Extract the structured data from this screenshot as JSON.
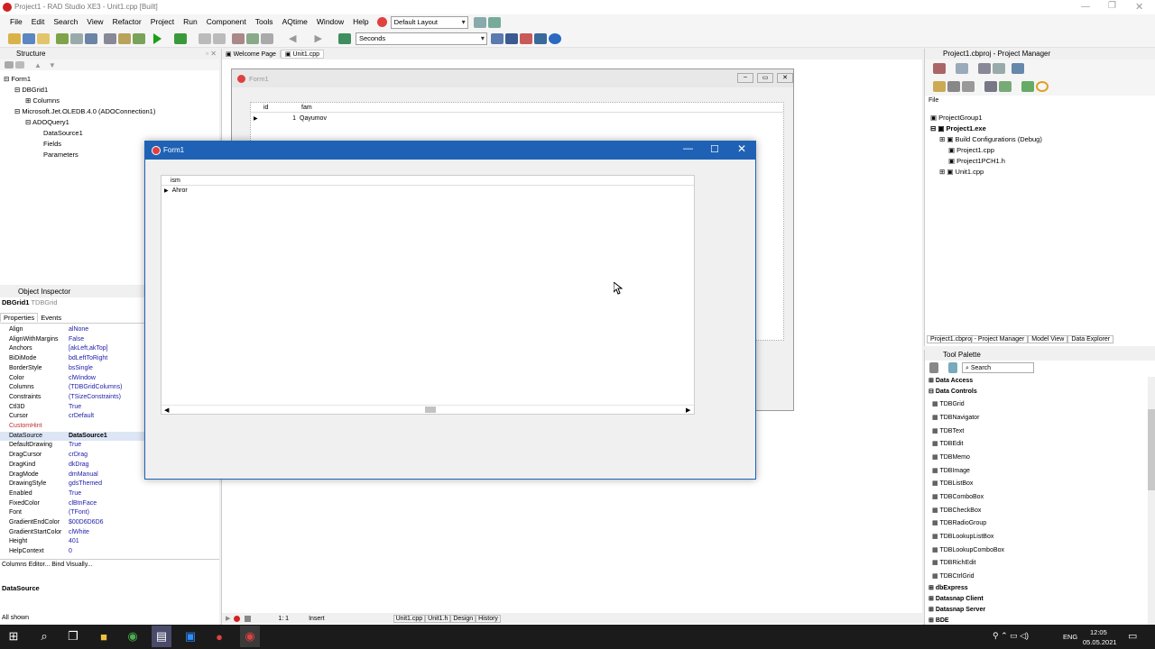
{
  "app": {
    "title": "Project1 - RAD Studio XE3 - Unit1.cpp [Built]",
    "menu": [
      "File",
      "Edit",
      "Search",
      "View",
      "Refactor",
      "Project",
      "Run",
      "Component",
      "Tools",
      "AQtime",
      "Window",
      "Help"
    ],
    "layout_combo": "Default Layout",
    "seconds_combo": "Seconds"
  },
  "structure": {
    "title": "Structure",
    "tree": [
      "Form1",
      "DBGrid1",
      "Columns",
      "Microsoft.Jet.OLEDB.4.0 (ADOConnection1)",
      "ADOQuery1",
      "DataSource1",
      "Fields",
      "Parameters"
    ]
  },
  "inspector": {
    "title": "Object Inspector",
    "component": "DBGrid1",
    "component_type": "TDBGrid",
    "tabs": [
      "Properties",
      "Events"
    ],
    "props": [
      [
        "Align",
        "alNone"
      ],
      [
        "AlignWithMargins",
        "False"
      ],
      [
        "Anchors",
        "[akLeft,akTop]"
      ],
      [
        "BiDiMode",
        "bdLeftToRight"
      ],
      [
        "BorderStyle",
        "bsSingle"
      ],
      [
        "Color",
        "clWindow"
      ],
      [
        "Columns",
        "(TDBGridColumns)"
      ],
      [
        "Constraints",
        "(TSizeConstraints)"
      ],
      [
        "Ctl3D",
        "True"
      ],
      [
        "Cursor",
        "crDefault"
      ],
      [
        "CustomHint",
        ""
      ],
      [
        "DataSource",
        "DataSource1"
      ],
      [
        "DefaultDrawing",
        "True"
      ],
      [
        "DragCursor",
        "crDrag"
      ],
      [
        "DragKind",
        "dkDrag"
      ],
      [
        "DragMode",
        "dmManual"
      ],
      [
        "DrawingStyle",
        "gdsThemed"
      ],
      [
        "Enabled",
        "True"
      ],
      [
        "FixedColor",
        "clBtnFace"
      ],
      [
        "Font",
        "(TFont)"
      ],
      [
        "GradientEndColor",
        "$00D6D6D6"
      ],
      [
        "GradientStartColor",
        "clWhite"
      ],
      [
        "Height",
        "401"
      ],
      [
        "HelpContext",
        "0"
      ]
    ],
    "links": "Columns Editor...  Bind Visually...",
    "footer_prop": "DataSource",
    "status": "All shown"
  },
  "editor": {
    "tabs": [
      "Welcome Page",
      "Unit1.cpp"
    ],
    "status_pos": "1:  1",
    "status_mode": "Insert",
    "bottom_tabs": [
      "Unit1.cpp",
      "Unit1.h",
      "Design",
      "History"
    ]
  },
  "design_form": {
    "title": "Form1",
    "headers": [
      "id",
      "fam"
    ],
    "row": [
      "1",
      "Qayumov"
    ]
  },
  "run_form": {
    "title": "Form1",
    "header": "ism",
    "row": "Ahror"
  },
  "project_manager": {
    "title": "Project1.cbproj - Project Manager",
    "file_label": "File",
    "tree": [
      "ProjectGroup1",
      "Project1.exe",
      "Build Configurations (Debug)",
      "Project1.cpp",
      "Project1PCH1.h",
      "Unit1.cpp"
    ],
    "tabs": [
      "Project1.cbproj - Project Manager",
      "Model View",
      "Data Explorer"
    ]
  },
  "tool_palette": {
    "title": "Tool Palette",
    "search_placeholder": "Search",
    "categories": [
      "Data Access",
      "Data Controls"
    ],
    "items": [
      "TDBGrid",
      "TDBNavigator",
      "TDBText",
      "TDBEdit",
      "TDBMemo",
      "TDBImage",
      "TDBListBox",
      "TDBComboBox",
      "TDBCheckBox",
      "TDBRadioGroup",
      "TDBLookupListBox",
      "TDBLookupComboBox",
      "TDBRichEdit",
      "TDBCtrlGrid"
    ],
    "more_categories": [
      "dbExpress",
      "Datasnap Client",
      "Datasnap Server",
      "BDE"
    ]
  },
  "taskbar": {
    "lang": "ENG",
    "time": "12:05",
    "date": "05.05.2021"
  }
}
